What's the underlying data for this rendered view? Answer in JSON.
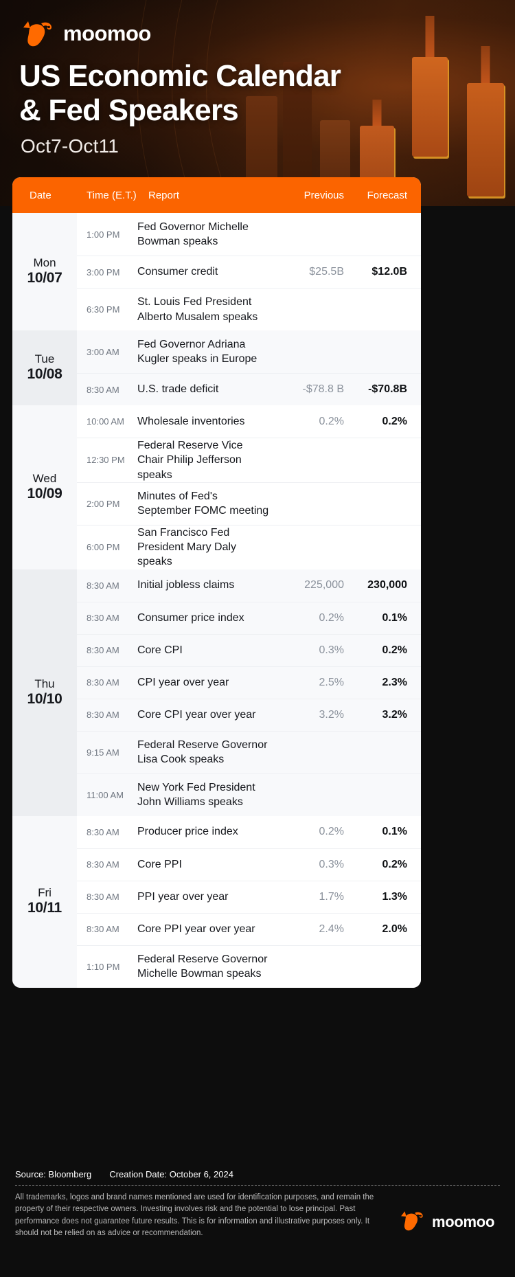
{
  "brand": {
    "name": "moomoo",
    "logo_icon": "moomoo-bull-logo",
    "accent_color": "#fb6400"
  },
  "hero": {
    "title_line1": "US Economic Calendar",
    "title_line2": "& Fed Speakers",
    "subtitle": "Oct7-Oct11"
  },
  "table": {
    "headers": {
      "date": "Date",
      "time": "Time (E.T.)",
      "report": "Report",
      "previous": "Previous",
      "forecast": "Forecast"
    },
    "days": [
      {
        "dow": "Mon",
        "date": "10/07",
        "rows": [
          {
            "time": "1:00 PM",
            "report": "Fed Governor Michelle Bowman speaks",
            "previous": "",
            "forecast": ""
          },
          {
            "time": "3:00 PM",
            "report": "Consumer credit",
            "previous": "$25.5B",
            "forecast": "$12.0B"
          },
          {
            "time": "6:30 PM",
            "report": "St. Louis Fed President Alberto Musalem speaks",
            "previous": "",
            "forecast": ""
          }
        ]
      },
      {
        "dow": "Tue",
        "date": "10/08",
        "rows": [
          {
            "time": "3:00 AM",
            "report": "Fed Governor Adriana Kugler speaks in Europe",
            "previous": "",
            "forecast": ""
          },
          {
            "time": "8:30 AM",
            "report": "U.S. trade deficit",
            "previous": "-$78.8 B",
            "forecast": "-$70.8B"
          }
        ]
      },
      {
        "dow": "Wed",
        "date": "10/09",
        "rows": [
          {
            "time": "10:00 AM",
            "report": "Wholesale inventories",
            "previous": "0.2%",
            "forecast": "0.2%"
          },
          {
            "time": "12:30 PM",
            "report": "Federal Reserve Vice Chair Philip Jefferson speaks",
            "previous": "",
            "forecast": ""
          },
          {
            "time": "2:00 PM",
            "report": "Minutes of Fed's September FOMC meeting",
            "previous": "",
            "forecast": ""
          },
          {
            "time": "6:00 PM",
            "report": "San Francisco Fed President Mary Daly speaks",
            "previous": "",
            "forecast": ""
          }
        ]
      },
      {
        "dow": "Thu",
        "date": "10/10",
        "rows": [
          {
            "time": "8:30 AM",
            "report": "Initial jobless claims",
            "previous": "225,000",
            "forecast": "230,000"
          },
          {
            "time": "8:30 AM",
            "report": "Consumer price index",
            "previous": "0.2%",
            "forecast": "0.1%"
          },
          {
            "time": "8:30 AM",
            "report": "Core CPI",
            "previous": "0.3%",
            "forecast": "0.2%"
          },
          {
            "time": "8:30 AM",
            "report": "CPI year over year",
            "previous": "2.5%",
            "forecast": "2.3%"
          },
          {
            "time": "8:30 AM",
            "report": "Core CPI year over year",
            "previous": "3.2%",
            "forecast": "3.2%"
          },
          {
            "time": "9:15 AM",
            "report": "Federal Reserve Governor Lisa Cook speaks",
            "previous": "",
            "forecast": ""
          },
          {
            "time": "11:00 AM",
            "report": "New York Fed President John Williams speaks",
            "previous": "",
            "forecast": ""
          }
        ]
      },
      {
        "dow": "Fri",
        "date": "10/11",
        "rows": [
          {
            "time": "8:30 AM",
            "report": "Producer price index",
            "previous": "0.2%",
            "forecast": "0.1%"
          },
          {
            "time": "8:30 AM",
            "report": "Core PPI",
            "previous": "0.3%",
            "forecast": "0.2%"
          },
          {
            "time": "8:30 AM",
            "report": "PPI year over year",
            "previous": "1.7%",
            "forecast": "1.3%"
          },
          {
            "time": "8:30 AM",
            "report": "Core PPI year over year",
            "previous": "2.4%",
            "forecast": "2.0%"
          },
          {
            "time": "1:10 PM",
            "report": "Federal Reserve Governor Michelle Bowman speaks",
            "previous": "",
            "forecast": ""
          }
        ]
      }
    ]
  },
  "footer": {
    "source": "Source: Bloomberg",
    "creation_date": "Creation Date: October 6, 2024",
    "disclaimer": "All trademarks, logos and brand names mentioned are used for identification purposes, and remain the property of their respective owners. Investing involves risk and the potential to lose principal. Past performance does not guarantee future results. This is for information and illustrative purposes only. It should not be relied on as advice or recommendation.",
    "logo_name": "moomoo"
  }
}
